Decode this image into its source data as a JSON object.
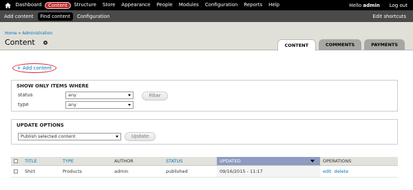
{
  "toolbar": {
    "items": [
      "Dashboard",
      "Content",
      "Structure",
      "Store",
      "Appearance",
      "People",
      "Modules",
      "Configuration",
      "Reports",
      "Help"
    ],
    "active_index": 1,
    "hello": "Hello",
    "username": "admin",
    "logout": "Log out"
  },
  "shortcuts": {
    "items": [
      "Add content",
      "Find content",
      "Configuration"
    ],
    "active_index": 1,
    "edit": "Edit shortcuts"
  },
  "header": {
    "breadcrumb_home": "Home",
    "breadcrumb_sep": "»",
    "breadcrumb_admin": "Administration",
    "title": "Content",
    "tabs": [
      "CONTENT",
      "COMMENTS",
      "PAYMENTS"
    ],
    "active_tab": 0
  },
  "actions": {
    "add_content": "+ Add content"
  },
  "filter": {
    "title": "SHOW ONLY ITEMS WHERE",
    "status_label": "status",
    "status_value": "any",
    "type_label": "type",
    "type_value": "any",
    "filter_button": "Filter"
  },
  "update": {
    "title": "UPDATE OPTIONS",
    "action_value": "Publish selected content",
    "update_button": "Update"
  },
  "table": {
    "headers": [
      "TITLE",
      "TYPE",
      "AUTHOR",
      "STATUS",
      "UPDATED",
      "OPERATIONS"
    ],
    "rows": [
      {
        "title": "Shirt",
        "type": "Products",
        "author": "admin",
        "status": "published",
        "updated": "09/16/2015 - 11:17",
        "edit": "edit",
        "delete": "delete"
      }
    ]
  }
}
